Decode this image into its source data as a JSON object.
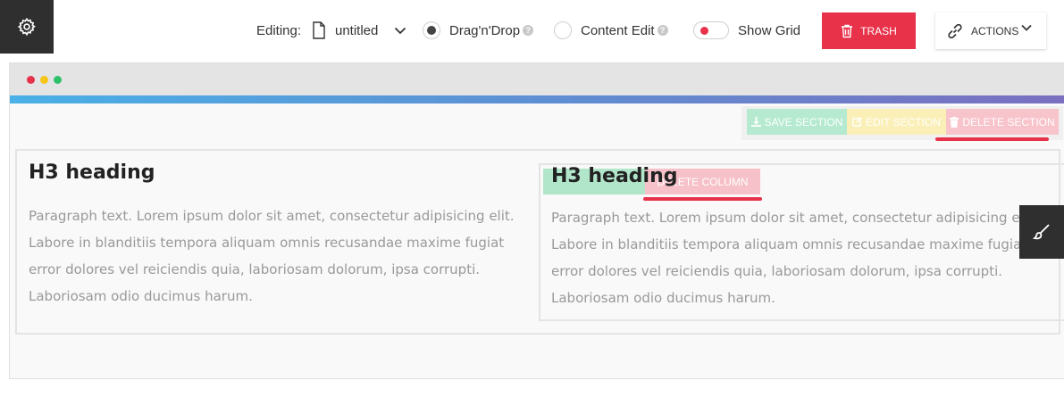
{
  "toolbar": {
    "editing_label": "Editing:",
    "file_name": "untitled",
    "modes": [
      {
        "label": "Drag'n'Drop",
        "selected": true
      },
      {
        "label": "Content Edit",
        "selected": false
      }
    ],
    "show_grid_label": "Show Grid",
    "trash_label": "TRASH",
    "actions_label": "ACTIONS",
    "help_glyph": "?"
  },
  "section_toolbar": {
    "save_label": "SAVE SECTION",
    "edit_label": "EDIT SECTION",
    "delete_label": "DELETE SECTION"
  },
  "column_toolbar": {
    "delete_label": "DELETE COLUMN"
  },
  "columns": [
    {
      "heading": "H3 heading",
      "paragraph_lines": [
        "Paragraph text. Lorem ipsum dolor sit amet, consectetur adipisicing elit.",
        "Labore in blanditiis tempora aliquam omnis recusandae maxime fugiat",
        "error dolores vel reiciendis quia, laboriosam dolorum, ipsa corrupti.",
        "Laboriosam odio ducimus harum."
      ]
    },
    {
      "heading": "H3 heading",
      "paragraph_lines": [
        "Paragraph text. Lorem ipsum dolor sit amet, consectetur adipisicing elit.",
        "Labore in blanditiis tempora aliquam omnis recusandae maxime fugiat",
        "error dolores vel reiciendis quia, laboriosam dolorum, ipsa corrupti.",
        "Laboriosam odio ducimus harum."
      ]
    }
  ],
  "colors": {
    "accent_red": "#e8324a",
    "dark": "#2f2f2f",
    "gradient_start": "#4ab0e6",
    "gradient_end": "#7a6fc0"
  },
  "icons": {
    "settings": "gear-icon",
    "file": "file-icon",
    "chevron": "chevron-down-icon",
    "trash": "trash-icon",
    "actions": "link-icon",
    "save": "download-icon",
    "edit": "edit-icon",
    "delete": "trash-icon",
    "side": "brush-icon"
  }
}
